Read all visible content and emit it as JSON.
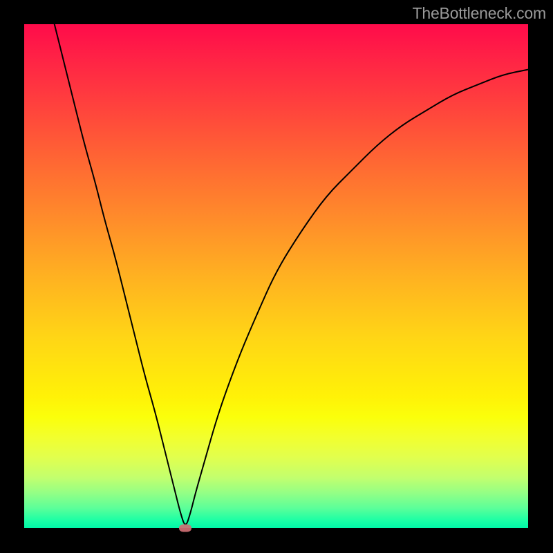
{
  "watermark": "TheBottleneck.com",
  "chart_data": {
    "type": "line",
    "title": "",
    "xlabel": "",
    "ylabel": "",
    "xlim": [
      0,
      100
    ],
    "ylim": [
      0,
      100
    ],
    "grid": false,
    "legend": false,
    "minimum_point": {
      "x": 32,
      "y": 0
    },
    "series": [
      {
        "name": "bottleneck-curve",
        "x": [
          6,
          8,
          10,
          12,
          14,
          16,
          18,
          20,
          22,
          24,
          26,
          28,
          30,
          31,
          32,
          33,
          34,
          36,
          38,
          40,
          43,
          46,
          50,
          55,
          60,
          65,
          70,
          75,
          80,
          85,
          90,
          95,
          100
        ],
        "y": [
          100,
          92,
          84,
          76,
          69,
          61,
          54,
          46,
          38,
          30,
          23,
          15,
          7,
          3,
          0,
          3,
          7,
          14,
          21,
          27,
          35,
          42,
          51,
          59,
          66,
          71,
          76,
          80,
          83,
          86,
          88,
          90,
          91
        ]
      }
    ],
    "marker": {
      "x": 32,
      "y": 0,
      "color": "#cf6f74"
    },
    "gradient_colors": {
      "top": "#ff0b4a",
      "mid_upper": "#ff8a2b",
      "mid": "#ffd516",
      "mid_lower": "#fbff0b",
      "bottom": "#00f7a8"
    }
  }
}
